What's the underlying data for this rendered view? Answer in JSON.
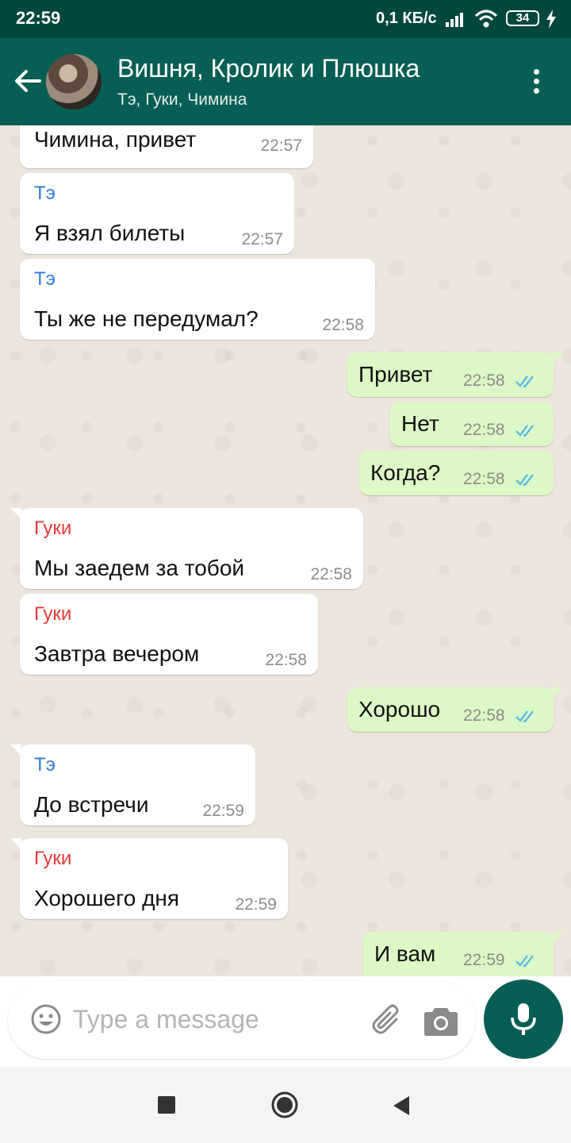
{
  "status_bar": {
    "time": "22:59",
    "network_speed": "0,1 КБ/с",
    "battery": "34"
  },
  "header": {
    "title": "Вишня, Кролик и Плюшка",
    "members": "Тэ, Гуки, Чимина"
  },
  "colors": {
    "header": "#075e54",
    "incoming": "#ffffff",
    "outgoing": "#dcf8c6",
    "te_name": "#2a7ae2",
    "guki_name": "#e53935",
    "read_ticks": "#4fb6ec"
  },
  "messages": [
    {
      "direction": "in",
      "sender": "",
      "text": "Чимина, привет",
      "time": "22:57"
    },
    {
      "direction": "in",
      "sender": "Тэ",
      "text": "Я взял билеты",
      "time": "22:57"
    },
    {
      "direction": "in",
      "sender": "Тэ",
      "text": "Ты же не передумал?",
      "time": "22:58"
    },
    {
      "direction": "out",
      "text": "Привет",
      "time": "22:58",
      "status": "read"
    },
    {
      "direction": "out",
      "text": "Нет",
      "time": "22:58",
      "status": "read"
    },
    {
      "direction": "out",
      "text": "Когда?",
      "time": "22:58",
      "status": "read"
    },
    {
      "direction": "in",
      "sender": "Гуки",
      "text": "Мы заедем за тобой",
      "time": "22:58"
    },
    {
      "direction": "in",
      "sender": "Гуки",
      "text": "Завтра вечером",
      "time": "22:58"
    },
    {
      "direction": "out",
      "text": "Хорошо",
      "time": "22:58",
      "status": "read"
    },
    {
      "direction": "in",
      "sender": "Тэ",
      "text": "До встречи",
      "time": "22:59"
    },
    {
      "direction": "in",
      "sender": "Гуки",
      "text": "Хорошего дня",
      "time": "22:59"
    },
    {
      "direction": "out",
      "text": "И вам",
      "time": "22:59",
      "status": "read"
    }
  ],
  "composer": {
    "placeholder": "Type a message"
  },
  "icons": {
    "back": "arrow-back-icon",
    "menu": "more-vert-icon",
    "emoji": "emoji-icon",
    "attach": "paperclip-icon",
    "camera": "camera-icon",
    "mic": "microphone-icon"
  }
}
